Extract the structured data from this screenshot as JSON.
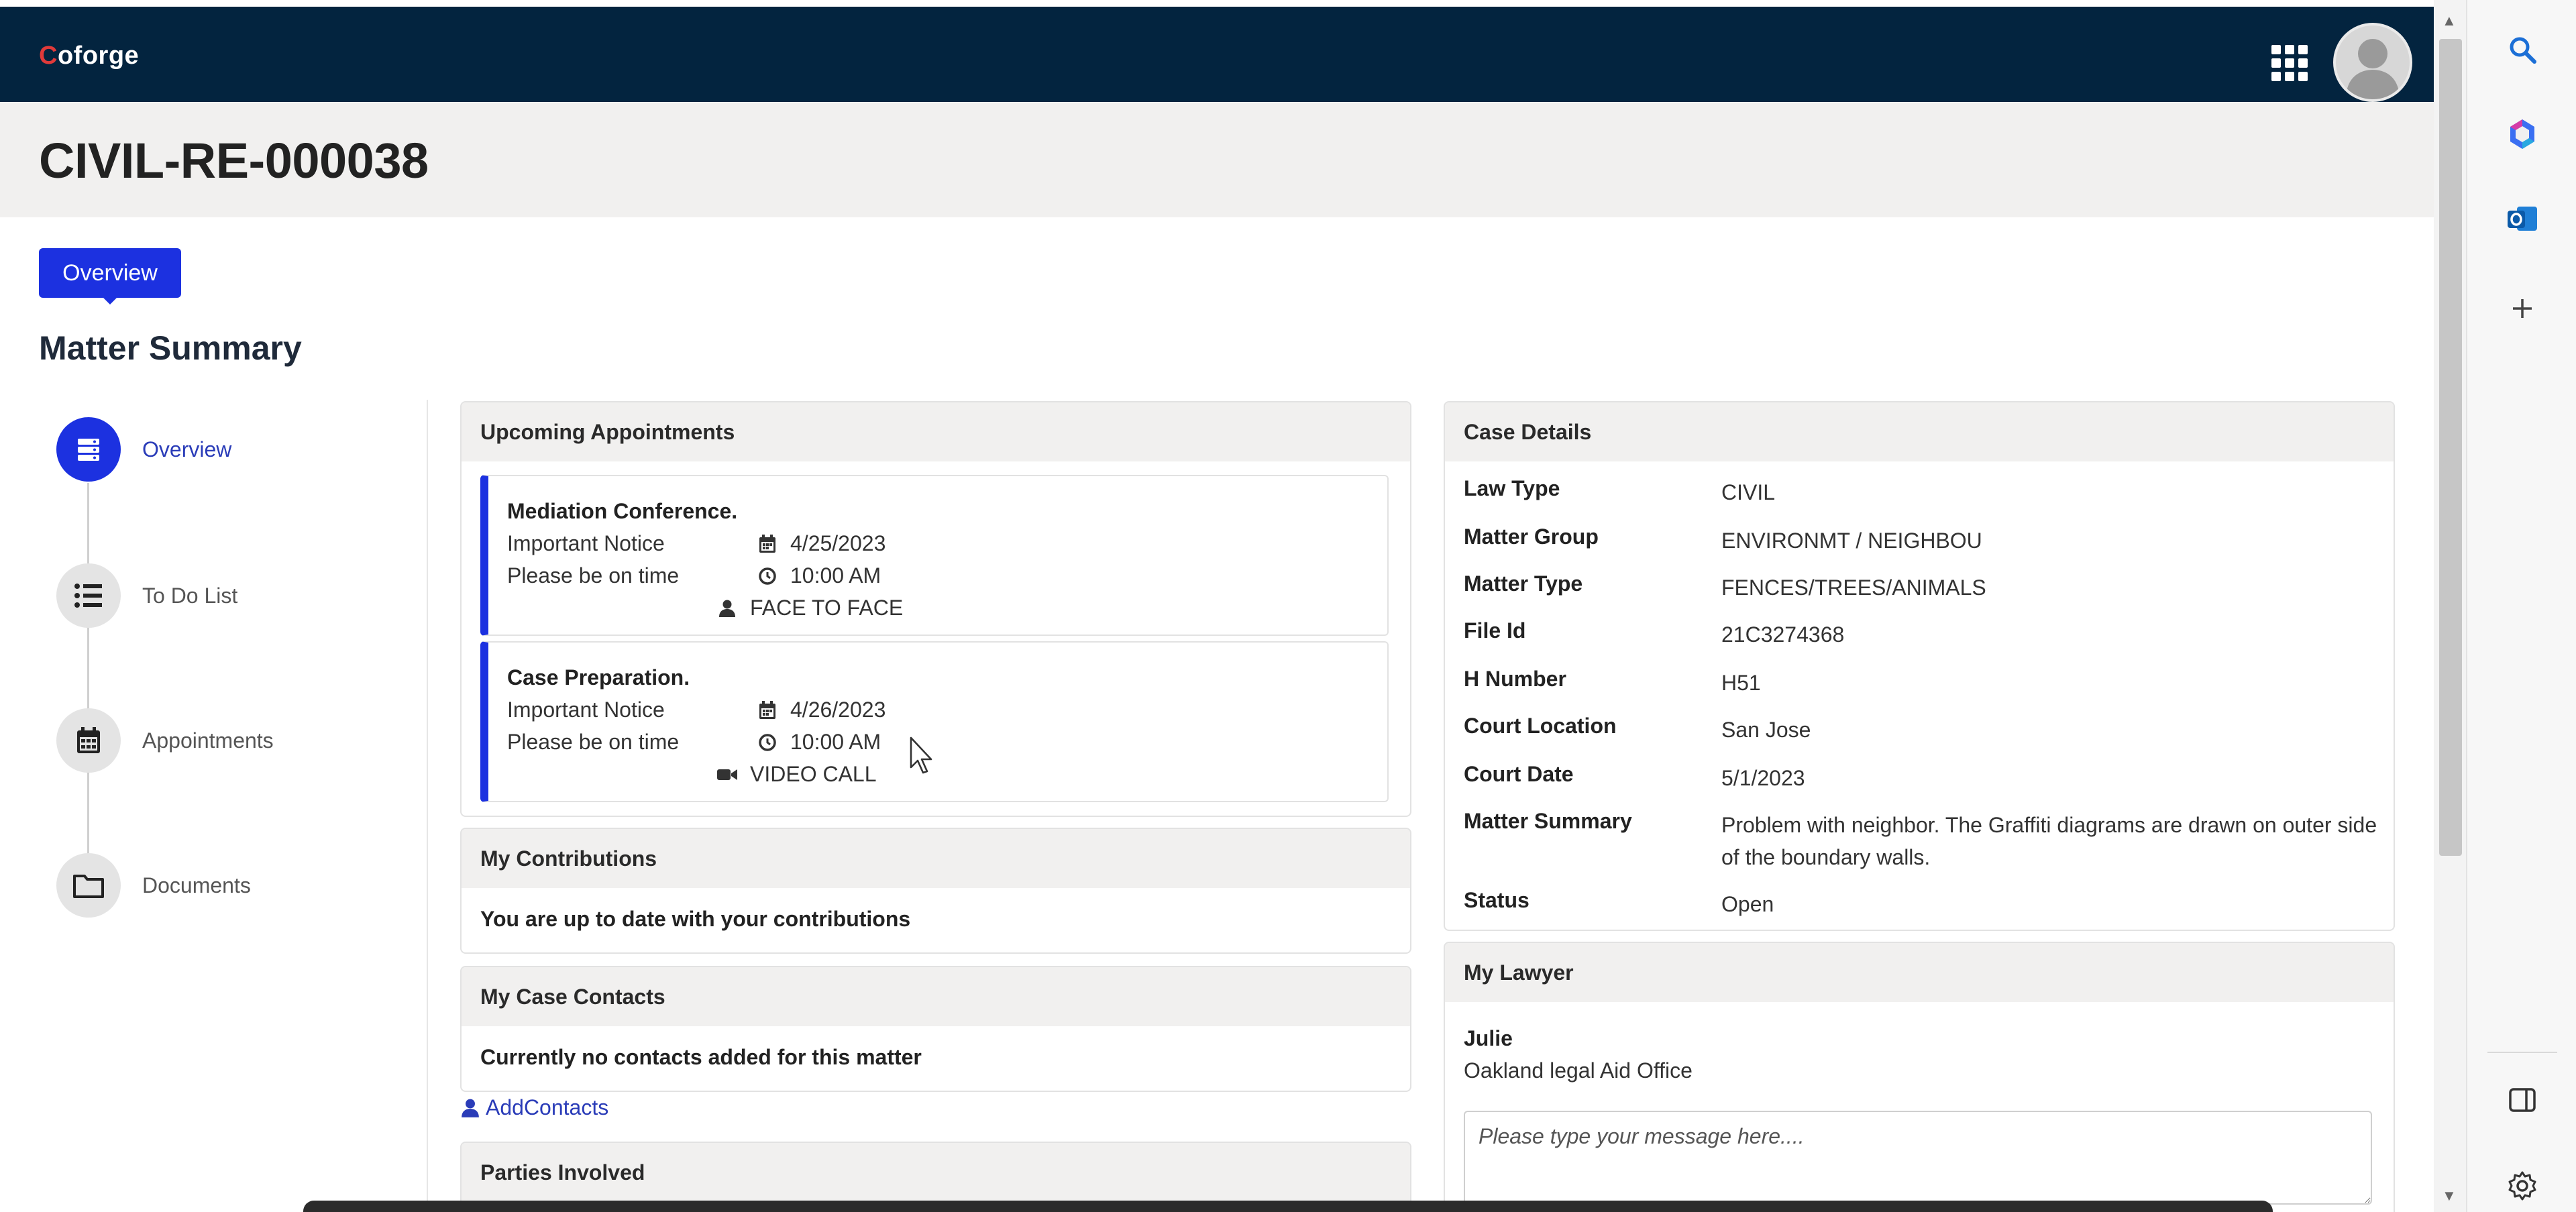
{
  "app": {
    "logo_prefix": "C",
    "logo_rest": "oforge"
  },
  "header": {
    "title": "CIVIL-RE-000038"
  },
  "tabs": [
    {
      "label": "Overview"
    }
  ],
  "section": {
    "title": "Matter Summary"
  },
  "stepper": [
    {
      "label": "Overview",
      "icon": "overview-icon",
      "active": true
    },
    {
      "label": "To Do List",
      "icon": "list-icon",
      "active": false
    },
    {
      "label": "Appointments",
      "icon": "calendar-icon",
      "active": false
    },
    {
      "label": "Documents",
      "icon": "folder-icon",
      "active": false
    }
  ],
  "appointments": {
    "title": "Upcoming Appointments",
    "items": [
      {
        "title": "Mediation Conference.",
        "line1": "Important Notice",
        "line2": "Please be on time",
        "date": "4/25/2023",
        "time": "10:00 AM",
        "mode": "FACE TO FACE",
        "mode_icon": "person-icon"
      },
      {
        "title": "Case Preparation.",
        "line1": "Important Notice",
        "line2": "Please be on time",
        "date": "4/26/2023",
        "time": "10:00 AM",
        "mode": "VIDEO CALL",
        "mode_icon": "video-icon"
      }
    ]
  },
  "contributions": {
    "title": "My Contributions",
    "text": "You are up to date with your contributions"
  },
  "contacts": {
    "title": "My Case Contacts",
    "text": "Currently no contacts added for this matter",
    "add_label": "AddContacts"
  },
  "parties": {
    "title": "Parties Involved"
  },
  "case_details": {
    "title": "Case Details",
    "rows": [
      {
        "k": "Law Type",
        "v": "CIVIL"
      },
      {
        "k": "Matter Group",
        "v": "ENVIRONMT / NEIGHBOU"
      },
      {
        "k": "Matter Type",
        "v": "FENCES/TREES/ANIMALS"
      },
      {
        "k": "File Id",
        "v": "21C3274368"
      },
      {
        "k": "H Number",
        "v": "H51"
      },
      {
        "k": "Court Location",
        "v": "San Jose"
      },
      {
        "k": "Court Date",
        "v": "5/1/2023"
      },
      {
        "k": "Matter Summary",
        "v": "Problem with neighbor. The Graffiti diagrams are drawn on outer side of the boundary walls."
      },
      {
        "k": "Status",
        "v": "Open"
      }
    ]
  },
  "lawyer": {
    "title": "My Lawyer",
    "name": "Julie",
    "office": "Oakland legal Aid Office",
    "message_placeholder": "Please type your message here...."
  },
  "colors": {
    "navy": "#03243f",
    "accent": "#1c31e0",
    "link": "#2a3cb8"
  }
}
